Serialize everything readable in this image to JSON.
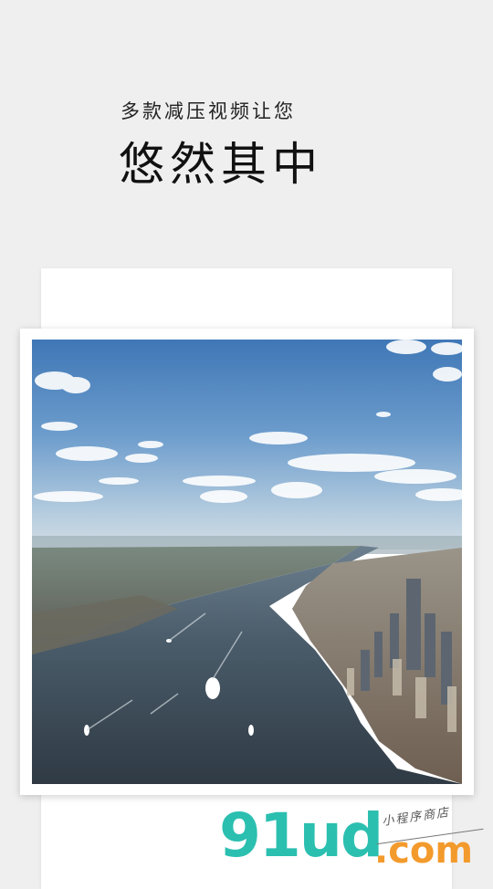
{
  "intro": {
    "subtitle": "多款减压视频让您",
    "headline": "悠然其中"
  },
  "watermark": {
    "logo": "91ud",
    "suffix": ".com",
    "tagline": "小程序商店"
  },
  "colors": {
    "background": "#efefef",
    "card": "#ffffff",
    "logo_teal": "#2bbfb0",
    "logo_orange": "#f39a2c"
  }
}
